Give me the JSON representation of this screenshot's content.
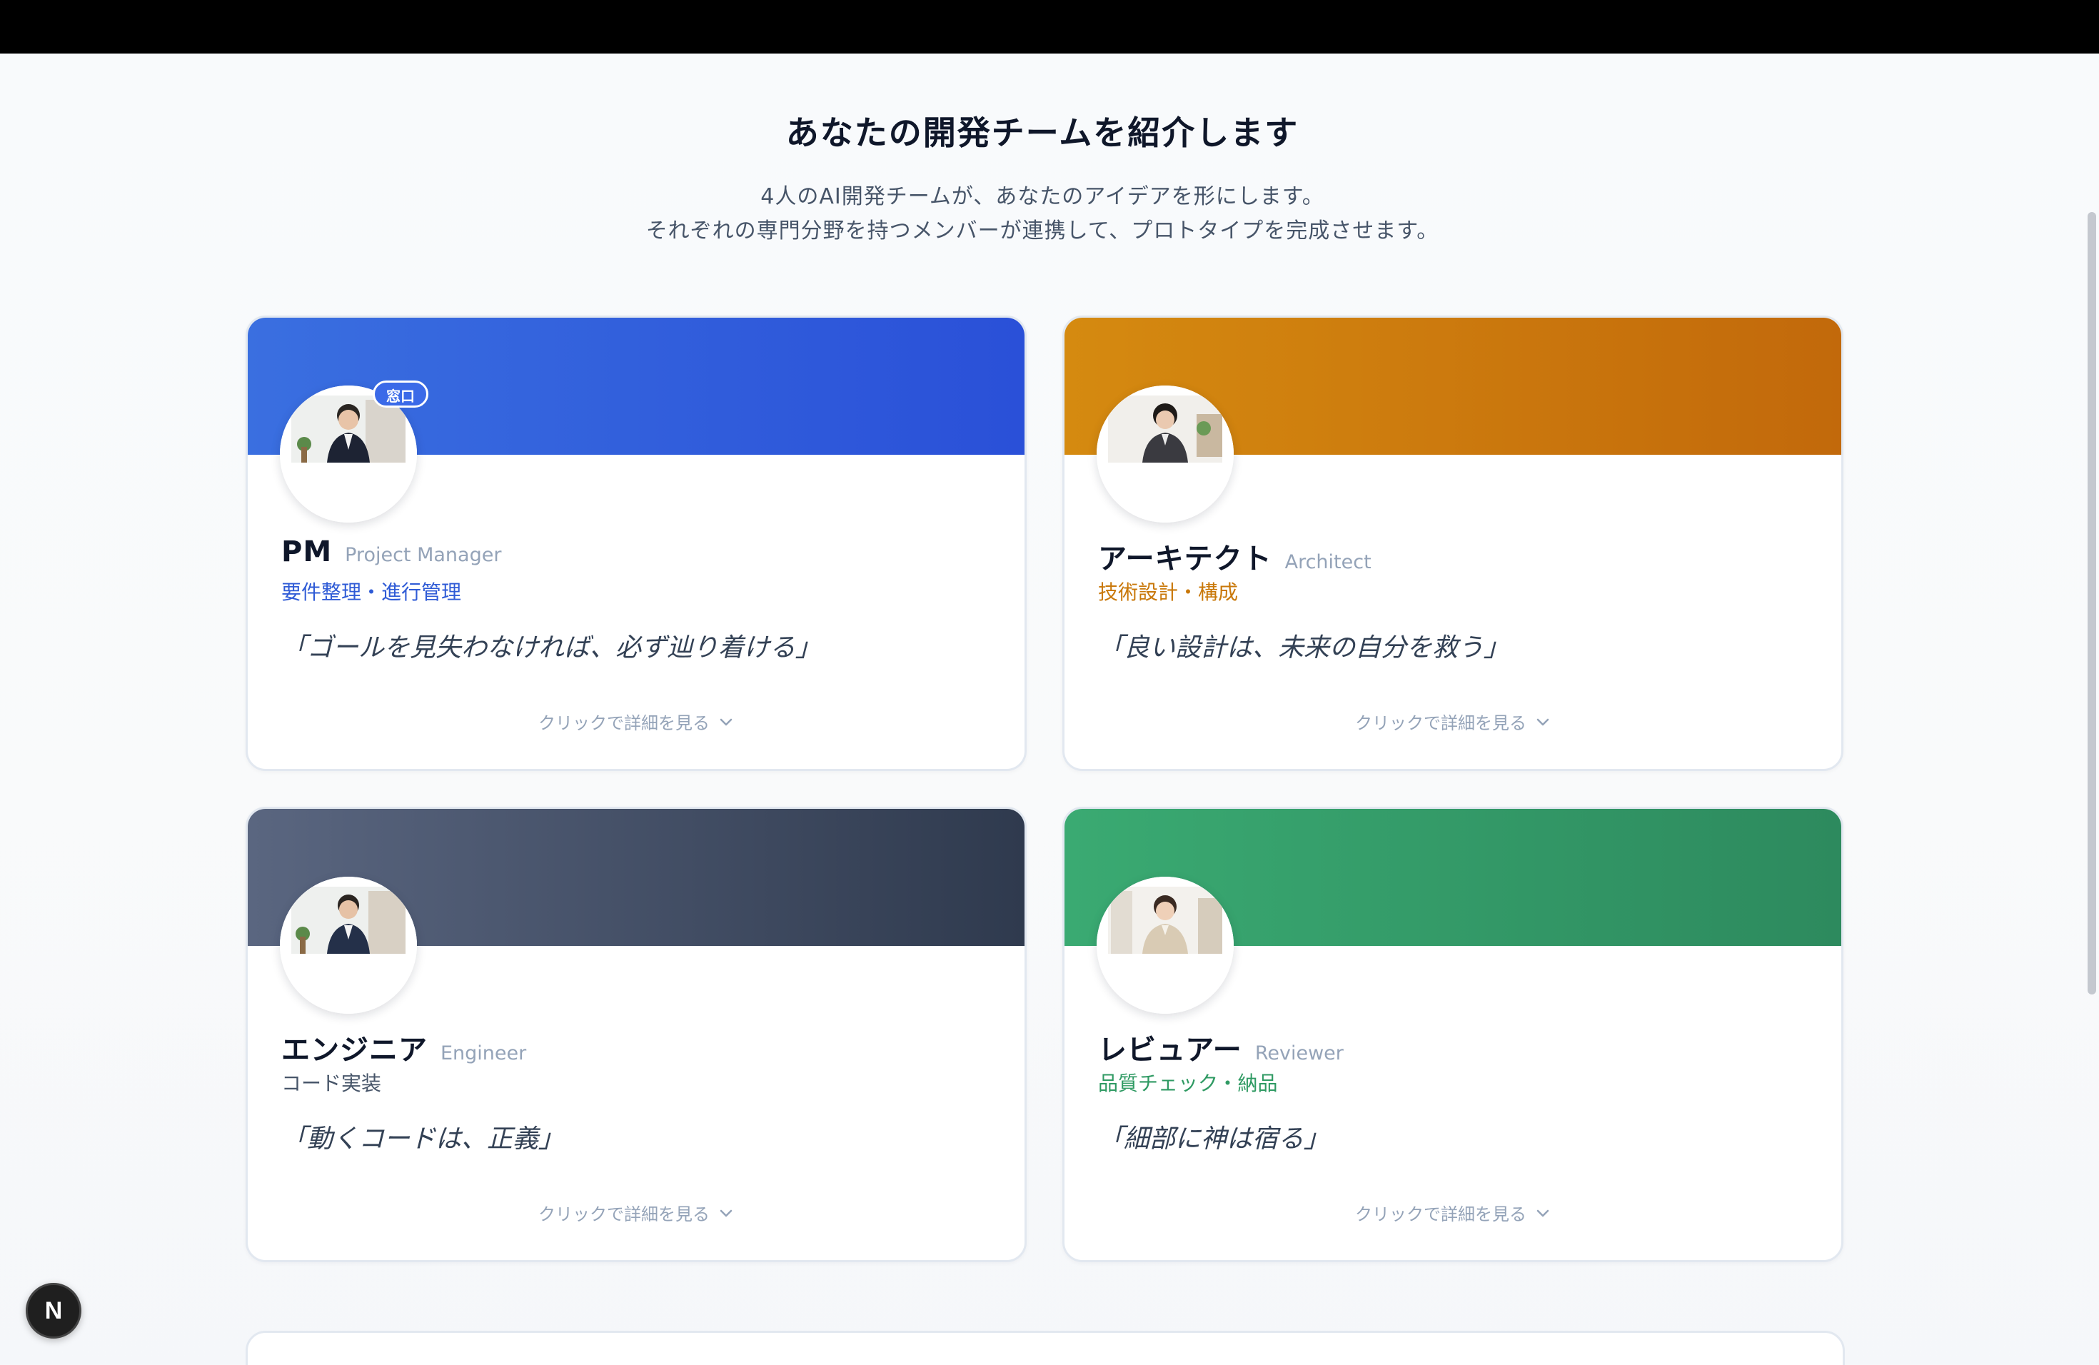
{
  "page": {
    "title": "あなたの開発チームを紹介します",
    "subtitle_line1": "4人のAI開発チームが、あなたのアイデアを形にします。",
    "subtitle_line2": "それぞれの専門分野を持つメンバーが連携して、プロトタイプを完成させます。"
  },
  "members": [
    {
      "role": "PM",
      "role_en": "Project Manager",
      "description": "要件整理・進行管理",
      "quote": "「ゴールを見失わなければ、必ず辿り着ける」",
      "badge": "窓口",
      "detail_label": "クリックで詳細を見る",
      "accent": "#2f5bd6",
      "header_from": "#3a6fe0",
      "header_to": "#2a50d8"
    },
    {
      "role": "アーキテクト",
      "role_en": "Architect",
      "description": "技術設計・構成",
      "quote": "「良い設計は、未来の自分を救う」",
      "detail_label": "クリックで詳細を見る",
      "accent": "#c9780a",
      "header_from": "#d58a10",
      "header_to": "#c2690b"
    },
    {
      "role": "エンジニア",
      "role_en": "Engineer",
      "description": "コード実装",
      "quote": "「動くコードは、正義」",
      "detail_label": "クリックで詳細を見る",
      "accent": "#475569",
      "header_from": "#5a6680",
      "header_to": "#2f3a4e"
    },
    {
      "role": "レビュアー",
      "role_en": "Reviewer",
      "description": "品質チェック・納品",
      "quote": "「細部に神は宿る」",
      "detail_label": "クリックで詳細を見る",
      "accent": "#2f9a63",
      "header_from": "#3aaa72",
      "header_to": "#2d8a5e"
    }
  ],
  "dev_indicator": {
    "label": "N"
  }
}
